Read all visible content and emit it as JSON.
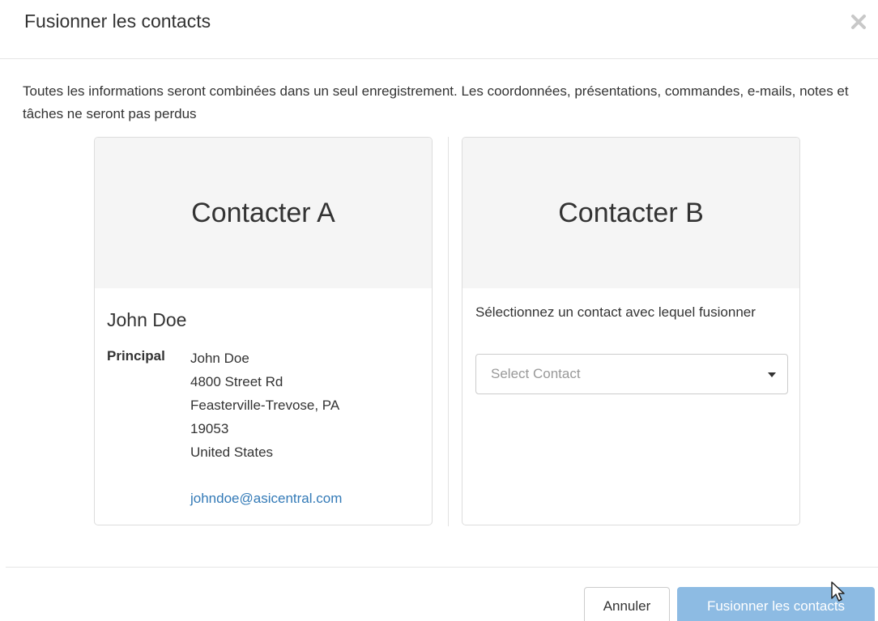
{
  "modal": {
    "title": "Fusionner les contacts",
    "close_icon": "close-icon"
  },
  "intro": "Toutes les informations seront combinées dans un seul enregistrement. Les coordonnées, présentations, commandes, e-mails, notes et tâches ne seront pas perdus",
  "contact_a": {
    "header": "Contacter A",
    "name": "John Doe",
    "address_label": "Principal",
    "address_lines": [
      "John Doe",
      "4800 Street Rd",
      "Feasterville-Trevose, PA",
      "19053",
      "United States"
    ],
    "email": "johndoe@asicentral.com"
  },
  "contact_b": {
    "header": "Contacter B",
    "prompt": "Sélectionnez un contact avec lequel fusionner",
    "select_placeholder": "Select Contact"
  },
  "footer": {
    "cancel_label": "Annuler",
    "merge_label": "Fusionner les contacts"
  },
  "colors": {
    "primary_button": "#8dbbe3",
    "link": "#337ab7",
    "card_header_bg": "#f5f5f5"
  }
}
